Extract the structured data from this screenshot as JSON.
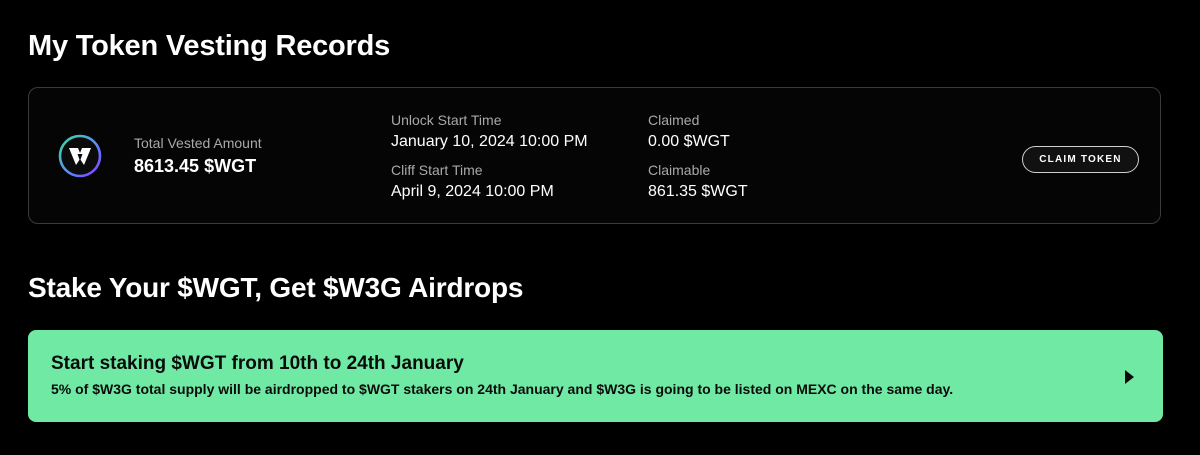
{
  "page": {
    "title": "My Token Vesting Records"
  },
  "vesting": {
    "total_label": "Total Vested Amount",
    "total_value": "8613.45 $WGT",
    "unlock_label": "Unlock Start Time",
    "unlock_value": "January 10, 2024 10:00 PM",
    "cliff_label": "Cliff Start Time",
    "cliff_value": "April 9, 2024 10:00 PM",
    "claimed_label": "Claimed",
    "claimed_value": "0.00 $WGT",
    "claimable_label": "Claimable",
    "claimable_value": "861.35 $WGT",
    "claim_button": "CLAIM TOKEN",
    "logo_icon": "wgt-logo-icon"
  },
  "staking": {
    "title": "Stake Your $WGT, Get $W3G Airdrops",
    "banner_heading": "Start staking $WGT from 10th to 24th January",
    "banner_text": "5% of $W3G total supply will be airdropped to $WGT stakers on 24th January and $W3G is going to be listed on MEXC on the same day.",
    "arrow_icon": "play-arrow-icon"
  },
  "colors": {
    "background": "#000000",
    "card_border": "#3a3a3a",
    "label_gray": "#a9a9a9",
    "banner_green": "#6fe9a3",
    "logo_ring_start": "#3ddc97",
    "logo_ring_end": "#7b3cff"
  }
}
